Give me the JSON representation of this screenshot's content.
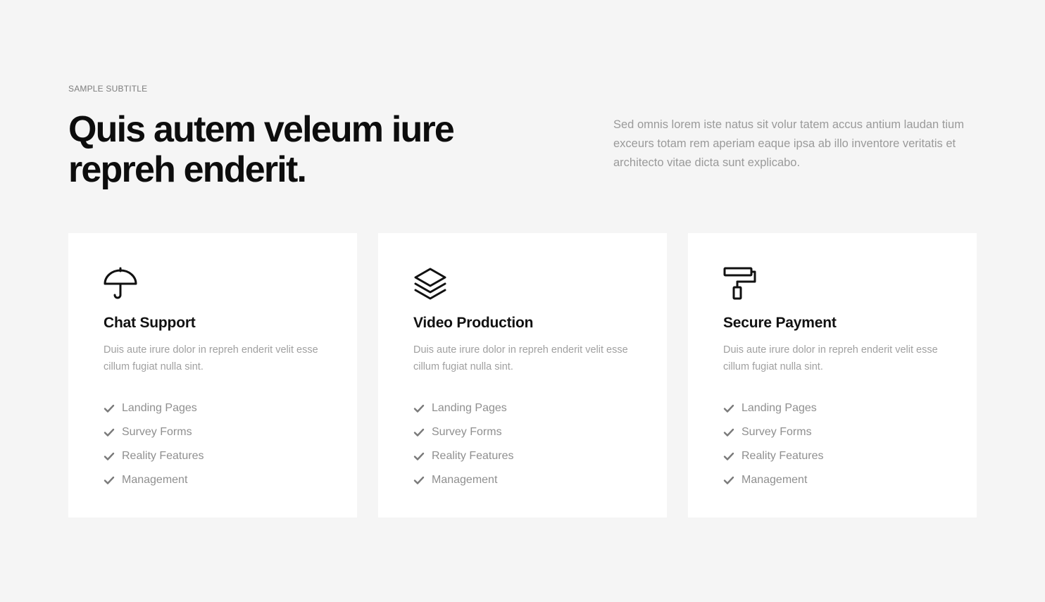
{
  "header": {
    "subtitle": "SAMPLE SUBTITLE",
    "headline_line1": "Quis autem veleum iure",
    "headline_line2": "repreh enderit.",
    "intro": "Sed omnis lorem iste natus sit volur tatem accus antium laudan tium exceurs totam rem aperiam eaque ipsa ab illo inventore veritatis et architecto vitae dicta sunt explicabo."
  },
  "colors": {
    "background": "#f5f5f5",
    "card_background": "#ffffff",
    "heading": "#0d0d0d",
    "muted_text": "#9a9a9a",
    "check": "#7a7a7a"
  },
  "cards": [
    {
      "icon": "umbrella-icon",
      "title": "Chat Support",
      "description": "Duis aute irure dolor in repreh enderit velit esse cillum fugiat nulla sint.",
      "features": [
        "Landing Pages",
        "Survey Forms",
        "Reality Features",
        "Management"
      ]
    },
    {
      "icon": "layers-icon",
      "title": "Video Production",
      "description": "Duis aute irure dolor in repreh enderit velit esse cillum fugiat nulla sint.",
      "features": [
        "Landing Pages",
        "Survey Forms",
        "Reality Features",
        "Management"
      ]
    },
    {
      "icon": "paint-roller-icon",
      "title": "Secure Payment",
      "description": "Duis aute irure dolor in repreh enderit velit esse cillum fugiat nulla sint.",
      "features": [
        "Landing Pages",
        "Survey Forms",
        "Reality Features",
        "Management"
      ]
    }
  ]
}
